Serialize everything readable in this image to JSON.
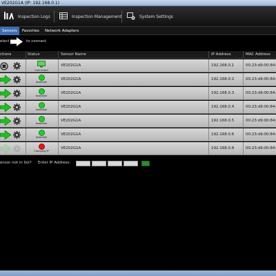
{
  "window": {
    "title": "VE202G1A (IP: 192.168.0.1)"
  },
  "menu": {
    "items": [
      {
        "label": "Inspection Logs",
        "icon": "logo-icon"
      },
      {
        "label": "Inspection Management",
        "icon": "grid-icon"
      },
      {
        "label": "System Settings",
        "icon": "settings-icon"
      }
    ]
  },
  "tabs": [
    {
      "label": "Sensors",
      "active": true
    },
    {
      "label": "Favorites",
      "active": false
    },
    {
      "label": "Network Adapters",
      "active": false
    }
  ],
  "hint": {
    "left": "elect",
    "right": "to connect"
  },
  "table": {
    "headers": {
      "actions": "ctions",
      "status": "Status",
      "name": "Sensor Name",
      "ip": "IP Address",
      "mac": "MAC Address"
    },
    "rows": [
      {
        "sensor_name": "VE202G1A",
        "ip": "192.168.0.1",
        "mac": "00:23:d9:00:84:...",
        "status_text": "Connected",
        "status_color": "#3cbf3c",
        "state": "connected"
      },
      {
        "sensor_name": "VE202G1A",
        "ip": "192.168.0.2",
        "mac": "00:23:d9:00:84:...",
        "status_text": "Available",
        "status_color": "#1fcf2b",
        "state": "available"
      },
      {
        "sensor_name": "VE202G1A",
        "ip": "192.168.0.3",
        "mac": "00:23:d9:00:84:...",
        "status_text": "Available",
        "status_color": "#1fcf2b",
        "state": "available"
      },
      {
        "sensor_name": "VE202G1A",
        "ip": "192.168.0.4",
        "mac": "00:23:d9:00:84:...",
        "status_text": "Available",
        "status_color": "#1fcf2b",
        "state": "available"
      },
      {
        "sensor_name": "VE202G1A",
        "ip": "192.168.0.5",
        "mac": "00:23:d9:00:84:...",
        "status_text": "Available",
        "status_color": "#1fcf2b",
        "state": "available"
      },
      {
        "sensor_name": "VE202G1A",
        "ip": "192.168.0.6",
        "mac": "00:23:d9:00:84:...",
        "status_text": "Available",
        "status_color": "#1fcf2b",
        "state": "available"
      },
      {
        "sensor_name": "VE202G1A",
        "ip": "192.168.0.8",
        "mac": "00:23:d9:00:84:...",
        "status_text": "Changing IP",
        "status_color": "#e01818",
        "state": "changing"
      }
    ]
  },
  "manual_entry": {
    "question": "ensor not in list?",
    "ip_label": "Enter IP Address:"
  },
  "colors": {
    "accent_tab": "#3d6fb6",
    "go_arrow": "#1fbf1f",
    "row_bg": "#c8c8c8"
  }
}
